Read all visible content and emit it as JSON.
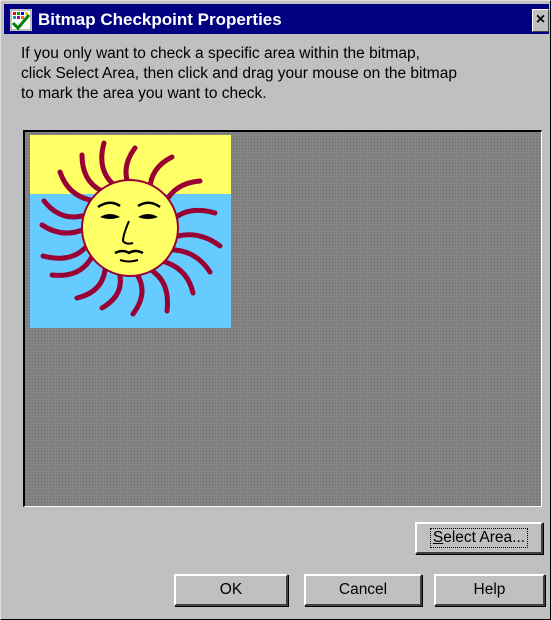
{
  "window": {
    "title": "Bitmap Checkpoint Properties",
    "close_glyph": "×"
  },
  "instructions": {
    "line1": "If you only want to check a specific area within the bitmap,",
    "line2": "click Select Area, then click and drag your mouse on the bitmap",
    "line3": "to mark the area you want to check."
  },
  "bitmap": {
    "content": "sun-face-image",
    "colors": {
      "sky_top": "#ffff66",
      "sky_bottom": "#66ccff",
      "rays": "#990033",
      "sun_face": "#ffff66",
      "frame_background": "#848484"
    }
  },
  "buttons": {
    "select_area_mnemonic": "S",
    "select_area_rest": "elect Area...",
    "ok": "OK",
    "cancel": "Cancel",
    "help": "Help"
  },
  "icons": {
    "title": "bitmap-checkpoint-icon"
  }
}
